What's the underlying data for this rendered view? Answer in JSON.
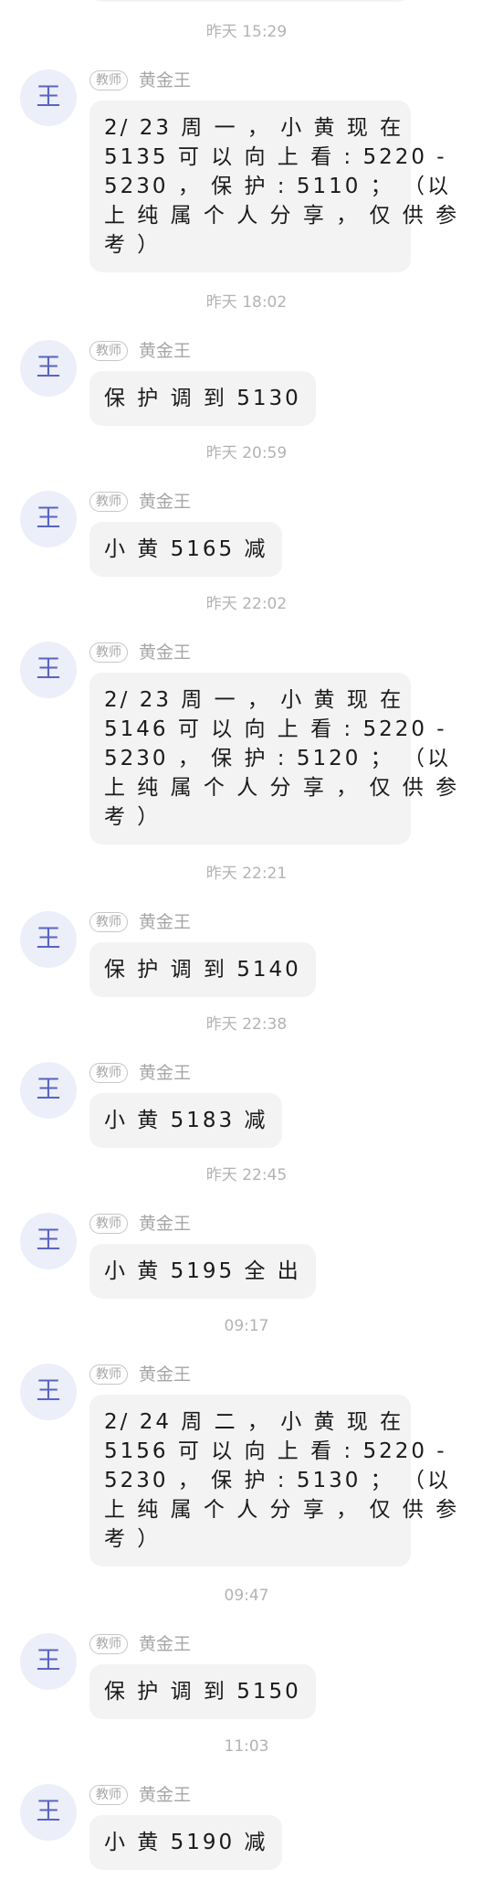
{
  "timestamps": [
    "昨天 15:29",
    "昨天 18:02",
    "昨天 20:59",
    "昨天 22:02",
    "昨天 22:21",
    "昨天 22:38",
    "昨天 22:45",
    "09:17",
    "09:47",
    "11:03"
  ],
  "messages": [
    {
      "avatar": "王",
      "role": "教师",
      "sender": "黄金王",
      "lines": [
        "2/ 23 周 一 ， 小 黄 现 在",
        "5135 可 以 向 上 看 : 5220 -",
        "5230 ， 保 护 : 5110 ；  （以",
        "上 纯 属 个 人 分 享 ， 仅 供 参",
        "考 ）"
      ]
    },
    {
      "avatar": "王",
      "role": "教师",
      "sender": "黄金王",
      "text": "保 护 调 到 5130"
    },
    {
      "avatar": "王",
      "role": "教师",
      "sender": "黄金王",
      "text": "小 黄 5165 减"
    },
    {
      "avatar": "王",
      "role": "教师",
      "sender": "黄金王",
      "lines": [
        "2/ 23 周 一 ， 小 黄 现 在",
        "5146 可 以 向 上 看 : 5220 -",
        "5230 ， 保 护 : 5120 ；  （以",
        "上 纯 属 个 人 分 享 ， 仅 供 参",
        "考 ）"
      ]
    },
    {
      "avatar": "王",
      "role": "教师",
      "sender": "黄金王",
      "text": "保 护 调 到 5140"
    },
    {
      "avatar": "王",
      "role": "教师",
      "sender": "黄金王",
      "text": "小 黄 5183 减"
    },
    {
      "avatar": "王",
      "role": "教师",
      "sender": "黄金王",
      "text": "小 黄 5195 全 出"
    },
    {
      "avatar": "王",
      "role": "教师",
      "sender": "黄金王",
      "lines": [
        "2/ 24 周 二 ， 小 黄 现 在",
        "5156 可 以 向 上 看 : 5220 -",
        "5230 ， 保 护 : 5130 ；  （以",
        "上 纯 属 个 人 分 享 ， 仅 供 参",
        "考 ）"
      ]
    },
    {
      "avatar": "王",
      "role": "教师",
      "sender": "黄金王",
      "text": "保 护 调 到 5150"
    },
    {
      "avatar": "王",
      "role": "教师",
      "sender": "黄金王",
      "text": "小 黄 5190 减"
    }
  ],
  "colors": {
    "bubble_bg": "#f3f3f3",
    "avatar_bg": "#eceef9",
    "avatar_fg": "#5a64c0",
    "timestamp": "#b3b3b3",
    "sender": "#a6a6a6"
  }
}
